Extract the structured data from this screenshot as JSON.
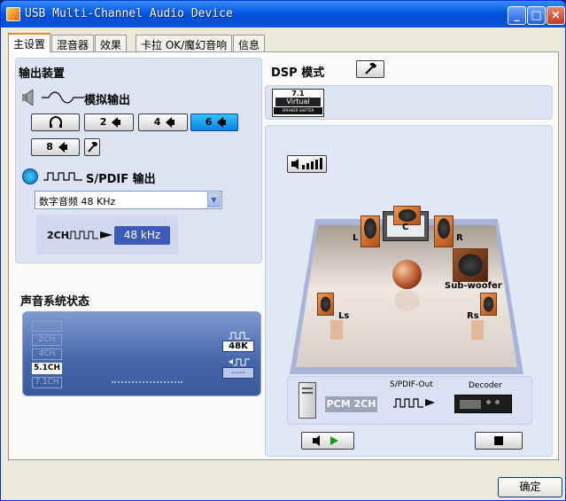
{
  "window": {
    "title": "USB Multi-Channel Audio Device",
    "minimize": "_",
    "maximize": "□",
    "close": "×"
  },
  "tabs": [
    {
      "label": "主设置",
      "active": true
    },
    {
      "label": "混音器"
    },
    {
      "label": "效果"
    },
    {
      "label": "卡拉 OK/魔幻音响"
    },
    {
      "label": "信息"
    }
  ],
  "output": {
    "heading": "输出装置",
    "analog_label": "模拟输出",
    "buttons": [
      "2",
      "4",
      "6",
      "8"
    ],
    "selected": "6",
    "spdif_label": "S/PDIF 输出",
    "spdif_select": "数字音频 48 KHz",
    "spdif_channel": "2CH",
    "spdif_rate": "48 kHz"
  },
  "status": {
    "heading": "声音系统状态",
    "items": [
      "2CH",
      "4CH",
      "5.1CH",
      "7.1CH"
    ],
    "selected": "5.1CH",
    "rate_in": "48K",
    "rate_out": "----"
  },
  "dsp": {
    "heading": "DSP 模式",
    "virtual_top": "7.1",
    "virtual_mid": "Virtual",
    "virtual_bottom": "SPEAKER SHIFTER",
    "speakers": {
      "center": "C",
      "left": "L",
      "right": "R",
      "sub": "Sub-woofer",
      "ls": "Ls",
      "rs": "Rs"
    },
    "pcm": "PCM 2CH",
    "spdif_out": "S/PDIF-Out",
    "decoder": "Decoder"
  },
  "ok_label": "确定",
  "colors": {
    "title_blue": "#0058e6",
    "selected_blue": "#0a7ee6",
    "panel": "#dde3f3",
    "speaker_orange": "#e07a35"
  }
}
